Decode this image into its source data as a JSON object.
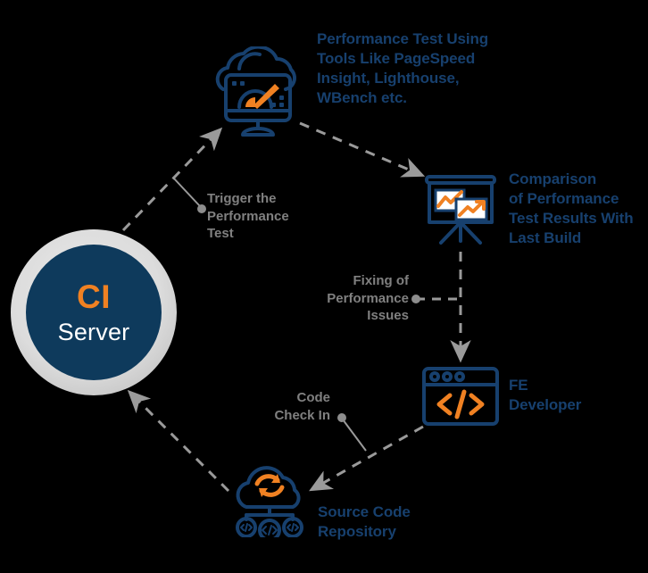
{
  "diagram": {
    "title": "CI performance testing feedback loop",
    "background_color": "#000000",
    "colors": {
      "navy": "#17406e",
      "node_navy": "#0e3a5c",
      "orange": "#f08122",
      "gray": "#808080",
      "white": "#ffffff",
      "ring_gray": "#dcdcdc"
    }
  },
  "ci_node": {
    "title": "CI",
    "subtitle": "Server"
  },
  "nodes": [
    {
      "id": "performance-test",
      "icon": "cloud-monitor-speedometer-icon",
      "label": "Performance Test Using\nTools Like PageSpeed\nInsight, Lighthouse,\nWBench etc."
    },
    {
      "id": "comparison",
      "icon": "presentation-board-chart-icon",
      "label": "Comparison\nof Performance\nTest Results With\nLast Build"
    },
    {
      "id": "fe-developer",
      "icon": "browser-code-window-icon",
      "label": "FE\nDeveloper"
    },
    {
      "id": "source-code-repository",
      "icon": "cloud-sync-repository-icon",
      "label": "Source Code\nRepository"
    }
  ],
  "connector_labels": [
    {
      "id": "trigger",
      "label": "Trigger the\nPerformance\nTest"
    },
    {
      "id": "fixing",
      "label": "Fixing of\nPerformance\nIssues"
    },
    {
      "id": "code-check-in",
      "label": "Code\nCheck In"
    }
  ]
}
